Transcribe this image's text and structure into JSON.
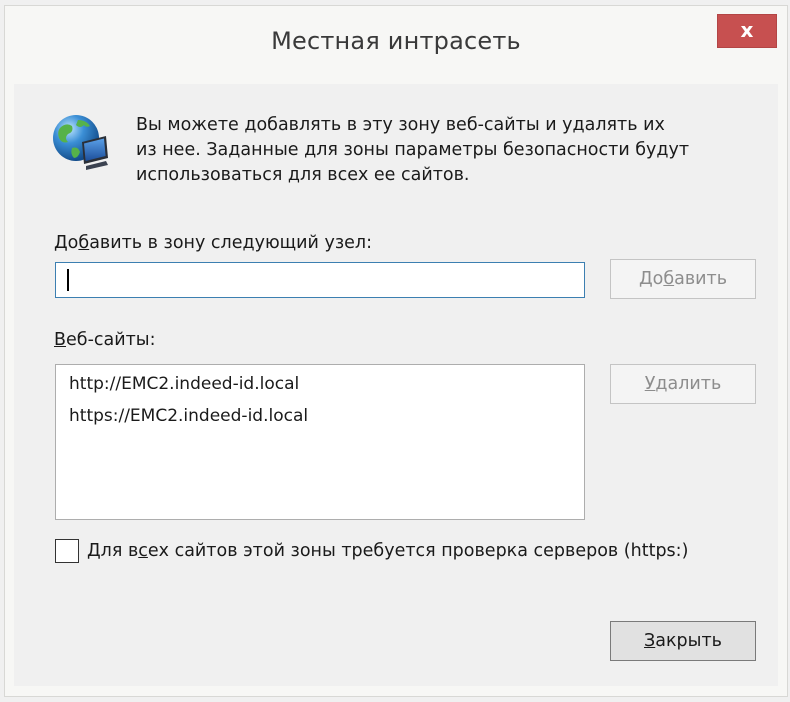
{
  "window": {
    "title": "Местная интрасеть",
    "close_glyph": "x"
  },
  "intro": {
    "icon": "globe-computer-icon",
    "line1": "Вы можете добавлять в эту зону  веб-сайты и удалять их",
    "line2": "из нее. Заданные для зоны параметры безопасности будут",
    "line3": "использоваться для всех ее сайтов."
  },
  "add_host": {
    "label_pre": "До",
    "label_accel": "б",
    "label_post": "авить в зону следующий узел:",
    "value": "",
    "placeholder": "",
    "button_pre": "До",
    "button_accel": "б",
    "button_post": "авить"
  },
  "sites": {
    "label_accel": "В",
    "label_post": "еб-сайты:",
    "items": [
      "http://EMC2.indeed-id.local",
      "https://EMC2.indeed-id.local"
    ],
    "remove_accel": "У",
    "remove_post": "далить"
  },
  "https_check": {
    "checked": false,
    "label_pre": "Для в",
    "label_accel": "с",
    "label_post": "ех сайтов этой зоны требуется проверка серверов (https:)"
  },
  "footer": {
    "close_accel": "З",
    "close_post": "акрыть"
  },
  "colors": {
    "close_button": "#c75050",
    "input_focus_border": "#3c7fb1",
    "background": "#f0f0f0"
  }
}
